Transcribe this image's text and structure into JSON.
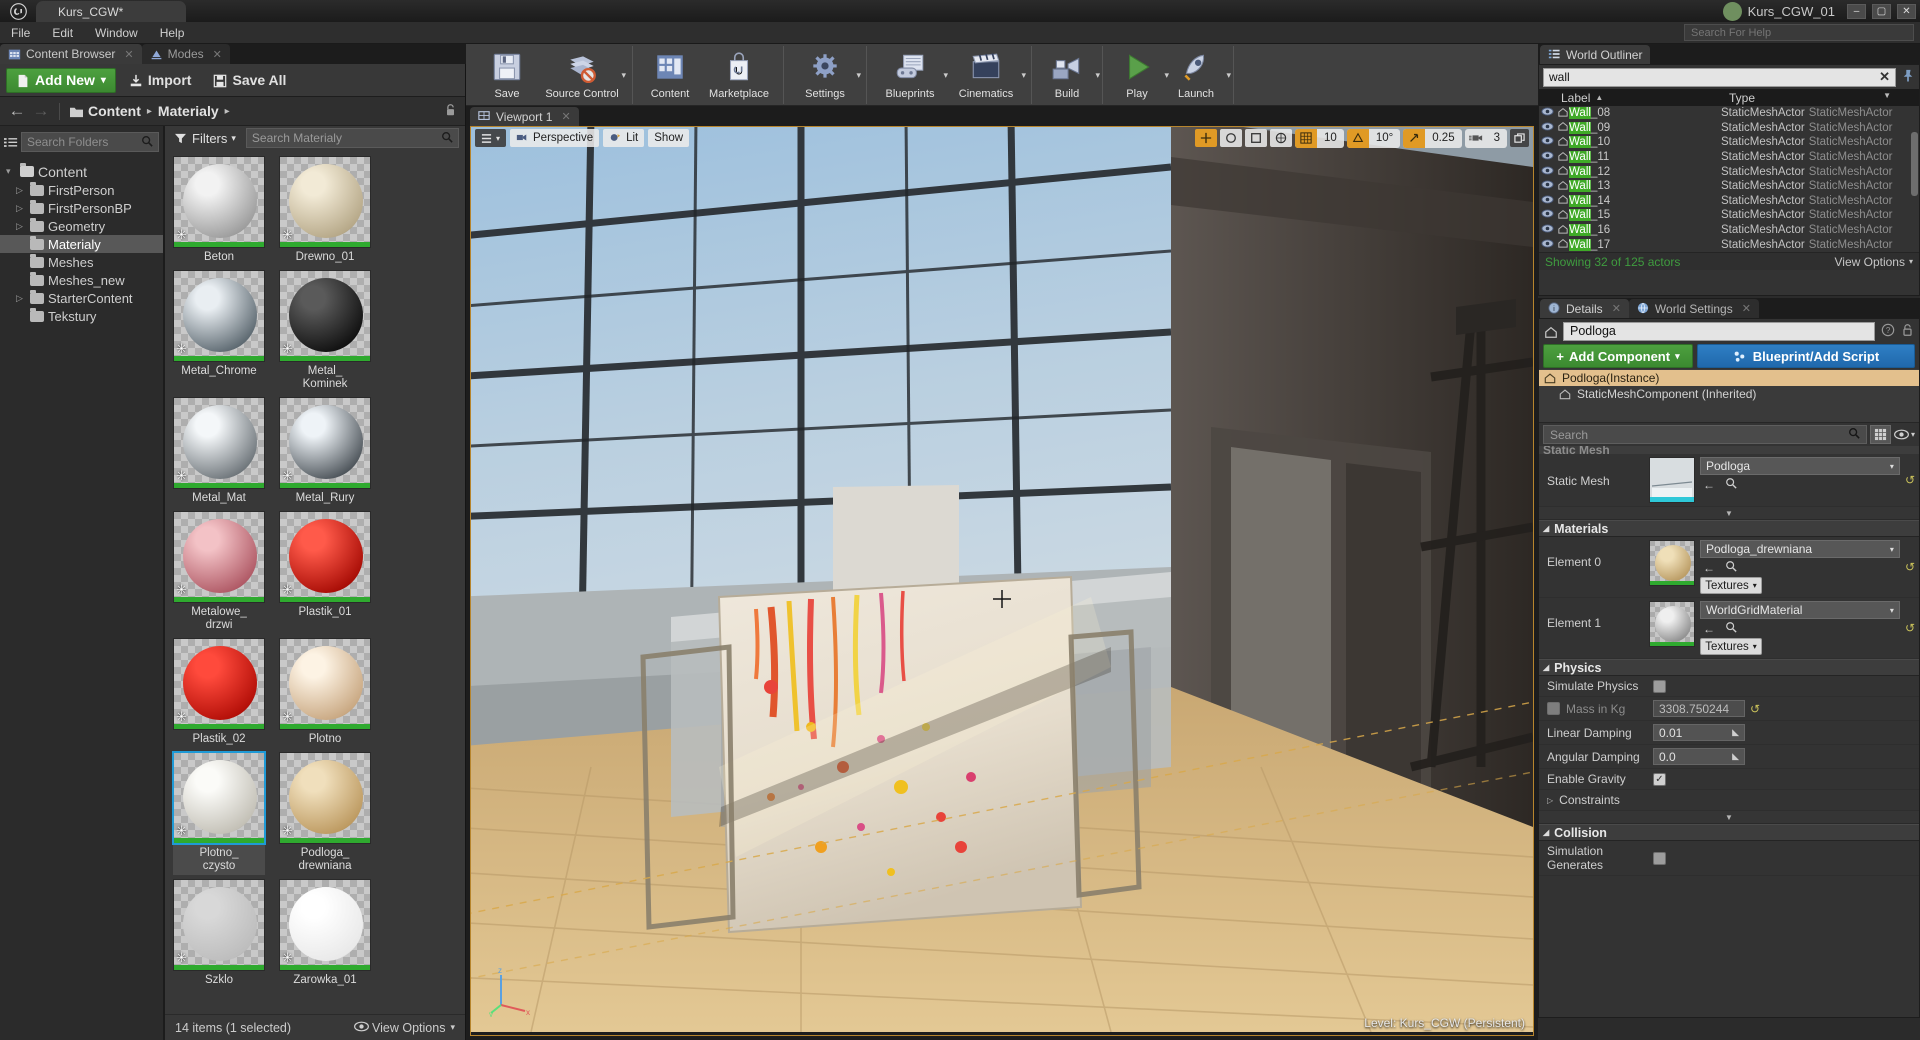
{
  "titlebar": {
    "project_tab": "Kurs_CGW*",
    "project_name": "Kurs_CGW_01",
    "minimize": "–",
    "maximize": "▢",
    "close": "✕"
  },
  "menubar": {
    "items": [
      "File",
      "Edit",
      "Window",
      "Help"
    ],
    "search_placeholder": "Search For Help"
  },
  "dock_tabs": [
    {
      "label": "Content Browser",
      "icon": "content-browser-icon",
      "close": "✕"
    },
    {
      "label": "Modes",
      "icon": "modes-icon",
      "close": "✕"
    }
  ],
  "content_browser": {
    "toolbar": {
      "add_new": "Add New",
      "add_new_caret": "▾",
      "import": "Import",
      "save_all": "Save All"
    },
    "path": {
      "back": "←",
      "forward": "→",
      "crumbs": [
        "Content",
        "Materialy"
      ],
      "separator": "▸",
      "lock": "🔓"
    },
    "folder_search_placeholder": "Search Folders",
    "asset_search_placeholder": "Search Materialy",
    "filters_label": "Filters",
    "tree": [
      {
        "label": "Content",
        "depth": 0,
        "twisty": "▾",
        "selected": false,
        "open": true
      },
      {
        "label": "FirstPerson",
        "depth": 1,
        "twisty": "▷",
        "selected": false,
        "open": false
      },
      {
        "label": "FirstPersonBP",
        "depth": 1,
        "twisty": "▷",
        "selected": false,
        "open": false
      },
      {
        "label": "Geometry",
        "depth": 1,
        "twisty": "▷",
        "selected": false,
        "open": false
      },
      {
        "label": "Materialy",
        "depth": 1,
        "twisty": "",
        "selected": true,
        "open": false
      },
      {
        "label": "Meshes",
        "depth": 1,
        "twisty": "",
        "selected": false,
        "open": false
      },
      {
        "label": "Meshes_new",
        "depth": 1,
        "twisty": "",
        "selected": false,
        "open": false
      },
      {
        "label": "StarterContent",
        "depth": 1,
        "twisty": "▷",
        "selected": false,
        "open": false
      },
      {
        "label": "Tekstury",
        "depth": 1,
        "twisty": "",
        "selected": false,
        "open": false
      }
    ],
    "assets": [
      {
        "name": "Beton",
        "color1": "#f2f2f2",
        "color2": "#9d9d9d",
        "selected": false
      },
      {
        "name": "Drewno_01",
        "color1": "#f2ead6",
        "color2": "#b6a888",
        "selected": false
      },
      {
        "name": "Metal_Chrome",
        "color1": "#e9eef2",
        "color2": "#5e6a72",
        "selected": false
      },
      {
        "name": "Metal_Kominek",
        "color1": "#5a5a5a",
        "color2": "#111111",
        "selected": false
      },
      {
        "name": "Metal_Mat",
        "color1": "#f4f7f9",
        "color2": "#70777c",
        "selected": false
      },
      {
        "name": "Metal_Rury",
        "color1": "#eef3f7",
        "color2": "#4f565c",
        "selected": false
      },
      {
        "name": "Metalowe_drzwi",
        "color1": "#f3c2c6",
        "color2": "#b05a66",
        "selected": false
      },
      {
        "name": "Plastik_01",
        "color1": "#ff5a4a",
        "color2": "#a80d06",
        "selected": false
      },
      {
        "name": "Plastik_02",
        "color1": "#ff4a3c",
        "color2": "#b30f08",
        "selected": false
      },
      {
        "name": "Plotno",
        "color1": "#fdf3e4",
        "color2": "#c9a882",
        "selected": false
      },
      {
        "name": "Plotno_czysto",
        "color1": "#fbfbf8",
        "color2": "#c3c0b6",
        "selected": true
      },
      {
        "name": "Podloga_drewniana",
        "color1": "#f0dfbc",
        "color2": "#bd9a61",
        "selected": false
      },
      {
        "name": "Szklo",
        "color1": "#d8d8d8",
        "color2": "#bdbdbd",
        "selected": false
      },
      {
        "name": "Zarowka_01",
        "color1": "#ffffff",
        "color2": "#e9e9e9",
        "selected": false
      }
    ],
    "status": "14 items (1 selected)",
    "view_options": "View Options"
  },
  "viewport": {
    "tab_label": "Viewport 1",
    "tab_close": "✕",
    "perspective": "Perspective",
    "lit": "Lit",
    "show": "Show",
    "level_text": "Level:  Kurs_CGW (Persistent)",
    "snap": {
      "grid_value": "10",
      "rotation_value": "10°",
      "scale_value": "0.25",
      "camera_speed": "3"
    }
  },
  "world_outliner": {
    "tab_label": "World Outliner",
    "search_value": "wall",
    "clear": "✕",
    "columns": {
      "label": "Label",
      "type": "Type",
      "sort": "▲",
      "filter": "▼"
    },
    "rows": [
      {
        "name_hl": "Wall",
        "name_rest": "_08",
        "type": "StaticMeshActor",
        "type2": "StaticMeshActor"
      },
      {
        "name_hl": "Wall",
        "name_rest": "_09",
        "type": "StaticMeshActor",
        "type2": "StaticMeshActor"
      },
      {
        "name_hl": "Wall",
        "name_rest": "_10",
        "type": "StaticMeshActor",
        "type2": "StaticMeshActor"
      },
      {
        "name_hl": "Wall",
        "name_rest": "_11",
        "type": "StaticMeshActor",
        "type2": "StaticMeshActor"
      },
      {
        "name_hl": "Wall",
        "name_rest": "_12",
        "type": "StaticMeshActor",
        "type2": "StaticMeshActor"
      },
      {
        "name_hl": "Wall",
        "name_rest": "_13",
        "type": "StaticMeshActor",
        "type2": "StaticMeshActor"
      },
      {
        "name_hl": "Wall",
        "name_rest": "_14",
        "type": "StaticMeshActor",
        "type2": "StaticMeshActor"
      },
      {
        "name_hl": "Wall",
        "name_rest": "_15",
        "type": "StaticMeshActor",
        "type2": "StaticMeshActor"
      },
      {
        "name_hl": "Wall",
        "name_rest": "_16",
        "type": "StaticMeshActor",
        "type2": "StaticMeshActor"
      },
      {
        "name_hl": "Wall",
        "name_rest": "_17",
        "type": "StaticMeshActor",
        "type2": "StaticMeshActor"
      }
    ],
    "status": "Showing 32 of 125 actors",
    "view_options": "View Options"
  },
  "details": {
    "tabs": [
      {
        "label": "Details",
        "icon": "details-icon",
        "active": true,
        "close": "✕"
      },
      {
        "label": "World Settings",
        "icon": "world-settings-icon",
        "active": false,
        "close": "✕"
      }
    ],
    "actor_name": "Podloga",
    "help": "?",
    "lock": "🔓",
    "add_component": "Add Component",
    "add_component_plus": "+",
    "add_component_caret": "▾",
    "blueprint_button": "Blueprint/Add Script",
    "components": [
      {
        "label": "Podloga(Instance)",
        "kind": "instance"
      },
      {
        "label": "StaticMeshComponent (Inherited)",
        "kind": "child"
      }
    ],
    "search_placeholder": "Search",
    "static_mesh": {
      "category_hidden": "Static Mesh",
      "label": "Static Mesh",
      "value": "Podloga",
      "back": "←",
      "browse": "🔍",
      "reset": "↺"
    },
    "materials": {
      "category": "Materials",
      "elements": [
        {
          "label": "Element 0",
          "value": "Podloga_drewniana",
          "textures_label": "Textures",
          "back": "←",
          "browse": "🔍",
          "reset": "↺",
          "thumb_color1": "#efdfb8",
          "thumb_color2": "#b99a62"
        },
        {
          "label": "Element 1",
          "value": "WorldGridMaterial",
          "textures_label": "Textures",
          "back": "←",
          "browse": "🔍",
          "reset": "↺",
          "thumb_color1": "#efefef",
          "thumb_color2": "#8d8d8d"
        }
      ]
    },
    "physics": {
      "category": "Physics",
      "rows": [
        {
          "label": "Simulate Physics",
          "type": "checkbox",
          "checked": false,
          "dim": false
        },
        {
          "label": "Mass in Kg",
          "type": "checkbox-value",
          "checked": false,
          "value": "3308.750244",
          "dim": true,
          "reset": "↺"
        },
        {
          "label": "Linear Damping",
          "type": "value",
          "value": "0.01",
          "spinner": "⇅"
        },
        {
          "label": "Angular Damping",
          "type": "value",
          "value": "0.0",
          "spinner": "⇅"
        },
        {
          "label": "Enable Gravity",
          "type": "checkbox",
          "checked": true,
          "dim": false
        },
        {
          "label": "Constraints",
          "type": "expand",
          "twisty": "▷"
        }
      ]
    },
    "collision": {
      "category": "Collision",
      "rows": [
        {
          "label": "Simulation Generates",
          "type": "checkbox",
          "checked": false
        }
      ]
    }
  }
}
